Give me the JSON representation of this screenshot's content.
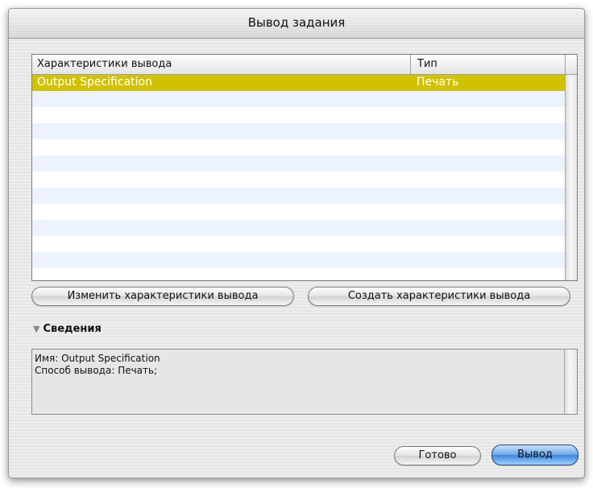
{
  "window": {
    "title": "Вывод задания"
  },
  "list": {
    "headers": {
      "name": "Характеристики вывода",
      "type": "Тип"
    },
    "rows": [
      {
        "name": "Output Specification",
        "type": "Печать"
      }
    ]
  },
  "buttons": {
    "edit": "Изменить характеристики вывода",
    "create": "Создать характеристики вывода",
    "done": "Готово",
    "output": "Вывод"
  },
  "details": {
    "label": "Сведения",
    "line1": "Имя: Output Specification",
    "line2": "Способ вывода: Печать;"
  },
  "colors": {
    "selection": "#d1c200",
    "row_stripe": "#edf3fe",
    "default_button": "#3f86db"
  }
}
